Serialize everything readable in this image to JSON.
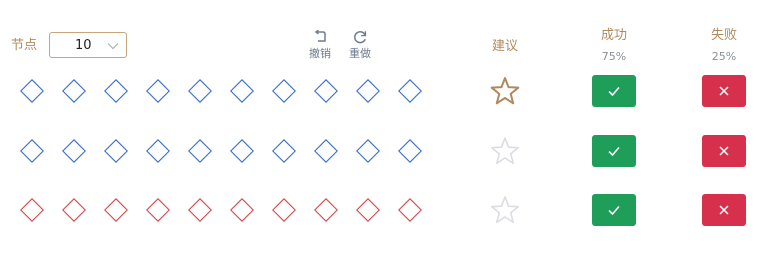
{
  "toolbar": {
    "node_label": "节点",
    "node_count": "10",
    "undo_label": "撤销",
    "redo_label": "重做"
  },
  "columns": {
    "suggest": "建议",
    "success": "成功",
    "success_rate": "75%",
    "fail": "失败",
    "fail_rate": "25%"
  },
  "rows": [
    {
      "nodes": 10,
      "node_color": "#3a6fd0",
      "star_active": true
    },
    {
      "nodes": 10,
      "node_color": "#3a6fd0",
      "star_active": false
    },
    {
      "nodes": 10,
      "node_color": "#d84a4a",
      "star_active": false
    }
  ],
  "colors": {
    "accent": "#b08a5e",
    "success": "#1e9e58",
    "fail": "#d6304c",
    "star_active": "#b08a5e",
    "star_inactive": "#dcdde3"
  },
  "icons": {
    "undo": "undo-icon",
    "redo": "redo-icon",
    "select_caret": "chevron-down-icon",
    "node": "diamond-icon",
    "suggest": "star-icon",
    "success": "check-icon",
    "fail": "close-icon"
  }
}
